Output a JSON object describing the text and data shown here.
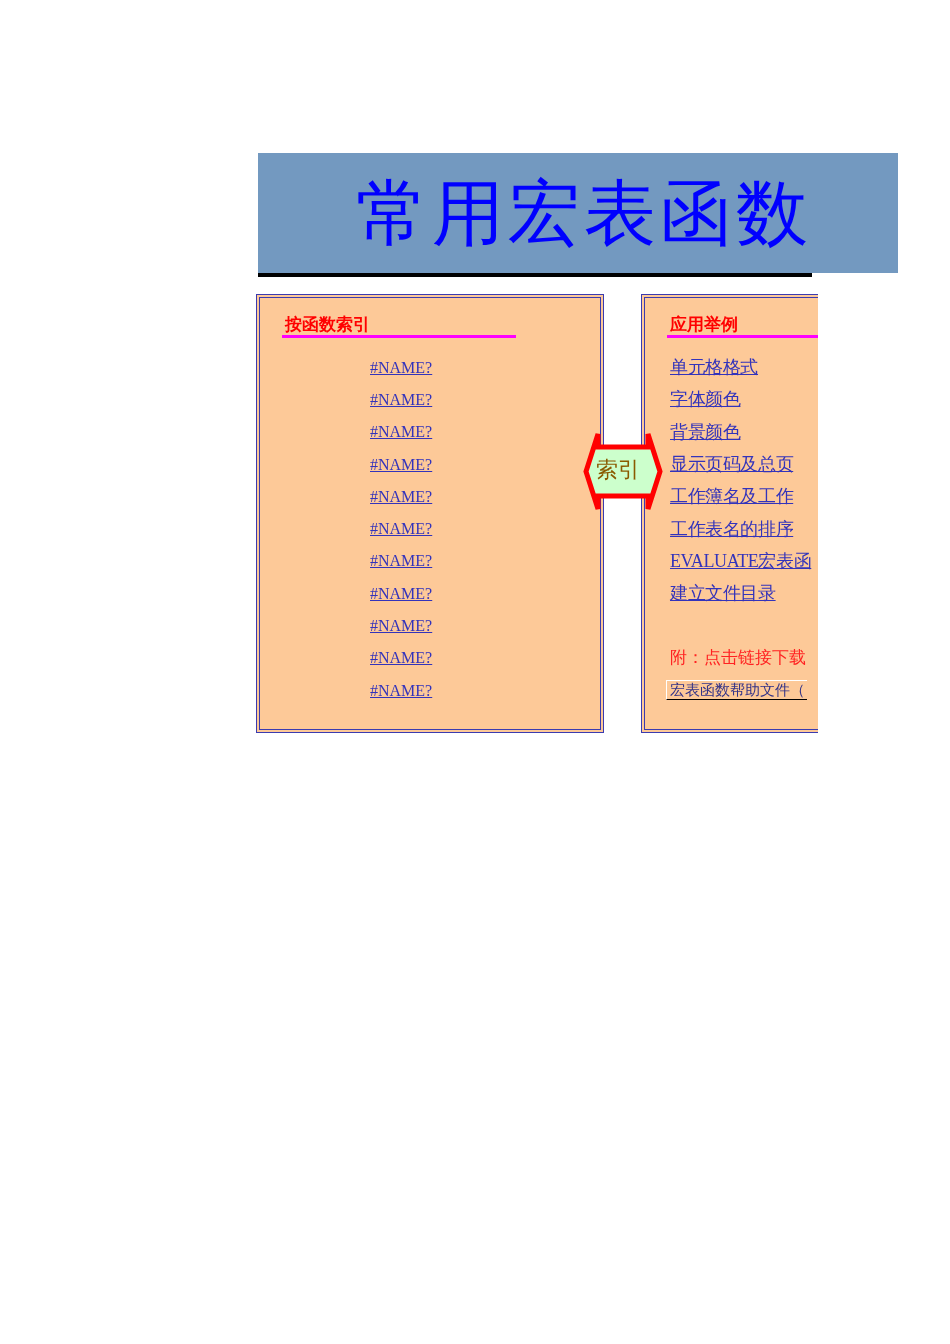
{
  "title": {
    "text": "常用宏表函数"
  },
  "index_panel": {
    "heading": "按函数索引",
    "links": [
      "#NAME?",
      "#NAME?",
      "#NAME?",
      "#NAME?",
      "#NAME?",
      "#NAME?",
      "#NAME?",
      "#NAME?",
      "#NAME?",
      "#NAME?",
      "#NAME?"
    ]
  },
  "arrow": {
    "label": "索引"
  },
  "examples_panel": {
    "heading": "应用举例",
    "links": [
      "单元格格式",
      "字体颜色",
      "背景颜色",
      "显示页码及总页",
      "工作簿名及工作",
      "工作表名的排序",
      "EVALUATE宏表函",
      "建立文件目录"
    ],
    "note": "附：点击链接下载",
    "download_link": "宏表函数帮助文件（"
  }
}
